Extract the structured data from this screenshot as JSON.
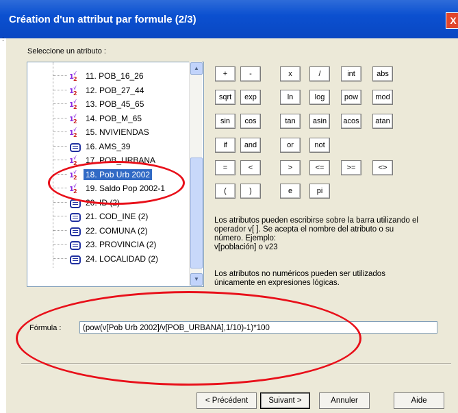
{
  "window": {
    "title": "Création d'un attribut par formule (2/3)",
    "close_label": "X"
  },
  "select_label": "Seleccione un atributo :",
  "attributes": [
    {
      "label": "11. POB_16_26",
      "type": "num"
    },
    {
      "label": "12. POB_27_44",
      "type": "num"
    },
    {
      "label": "13. POB_45_65",
      "type": "num"
    },
    {
      "label": "14. POB_M_65",
      "type": "num"
    },
    {
      "label": "15. NVIVIENDAS",
      "type": "num"
    },
    {
      "label": "16. AMS_39",
      "type": "text"
    },
    {
      "label": "17. POB_URBANA",
      "type": "num"
    },
    {
      "label": "18. Pob Urb 2002",
      "type": "num",
      "selected": true
    },
    {
      "label": "19. Saldo Pop 2002-1",
      "type": "num"
    },
    {
      "label": "20. ID (2)",
      "type": "text"
    },
    {
      "label": "21. COD_INE (2)",
      "type": "text"
    },
    {
      "label": "22. COMUNA (2)",
      "type": "text"
    },
    {
      "label": "23. PROVINCIA (2)",
      "type": "text"
    },
    {
      "label": "24. LOCALIDAD (2)",
      "type": "text"
    }
  ],
  "operators": {
    "row1": [
      "+",
      "-",
      "x",
      "/",
      "int",
      "abs"
    ],
    "row2": [
      "sqrt",
      "exp",
      "ln",
      "log",
      "pow",
      "mod"
    ],
    "row3": [
      "sin",
      "cos",
      "tan",
      "asin",
      "acos",
      "atan"
    ],
    "row4": [
      "if",
      "and",
      "or",
      "not"
    ],
    "row5": [
      "=",
      "<",
      ">",
      "<=",
      ">=",
      "<>"
    ],
    "row6": [
      "(",
      ")",
      "e",
      "pi"
    ]
  },
  "info1": [
    "Los atributos pueden escribirse sobre la barra utilizando el",
    "operador v[ ]. Se acepta el nombre del atributo o su",
    "número. Ejemplo:",
    "v[población] o v23"
  ],
  "info2": [
    "Los atributos no numéricos pueden ser utilizados",
    "únicamente en expresiones lógicas."
  ],
  "formula": {
    "label": "Fórmula :",
    "value": "(pow(v[Pob Urb 2002]/v[POB_URBANA],1/10)-1)*100"
  },
  "nav": {
    "prev": "< Précédent",
    "next": "Suivant >",
    "cancel": "Annuler",
    "help": "Aide"
  },
  "colors": {
    "highlight": "#e8101a",
    "selection": "#316ac5",
    "title_bar": "#0a47c2"
  }
}
